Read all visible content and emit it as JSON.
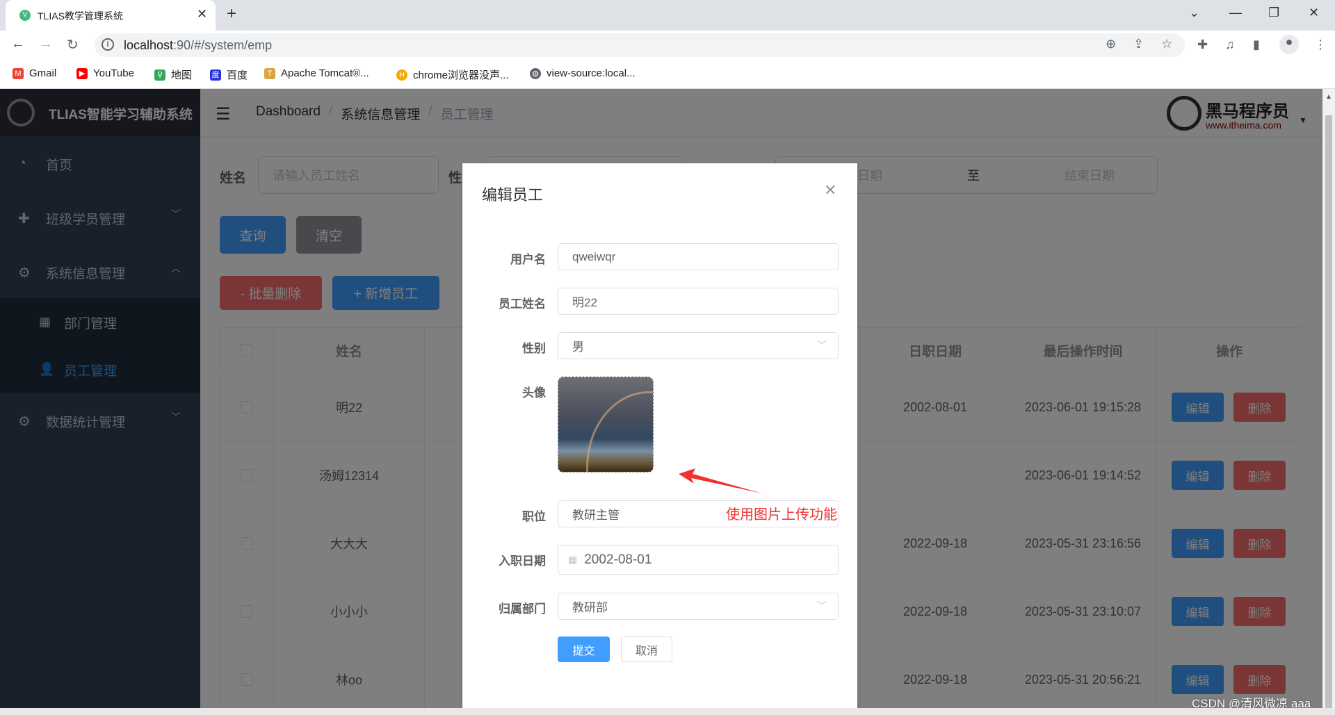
{
  "browser": {
    "tab_title": "TLIAS教学管理系统",
    "url_host": "localhost",
    "url_rest": ":90/#/system/emp",
    "bookmarks": [
      "Gmail",
      "YouTube",
      "地图",
      "百度",
      "Apache Tomcat®...",
      "chrome浏览器没声...",
      "view-source:local..."
    ]
  },
  "app": {
    "title": "TLIAS智能学习辅助系统",
    "brand_name": "黑马程序员",
    "brand_url": "www.itheima.com",
    "breadcrumb": [
      "Dashboard",
      "系统信息管理",
      "员工管理"
    ]
  },
  "sidebar": {
    "items": [
      {
        "label": "首页",
        "icon": "dashboard-icon"
      },
      {
        "label": "班级学员管理",
        "icon": "circle-plus-icon"
      },
      {
        "label": "系统信息管理",
        "icon": "gear-icon"
      },
      {
        "label": "数据统计管理",
        "icon": "gear-icon"
      }
    ],
    "sub_items": [
      {
        "label": "部门管理",
        "icon": "grid-icon"
      },
      {
        "label": "员工管理",
        "icon": "user-icon",
        "active": true
      }
    ]
  },
  "search": {
    "name_label": "姓名",
    "name_placeholder": "请输入员工姓名",
    "gender_label": "性",
    "start_placeholder": "开始日期",
    "range_sep": "至",
    "end_placeholder": "结束日期",
    "query": "查询",
    "clear": "清空",
    "batch_delete": "- 批量删除",
    "add": "+ 新增员工"
  },
  "table": {
    "headers": {
      "name": "姓名",
      "entry_date": "日职日期",
      "update_time": "最后操作时间",
      "actions": "操作"
    },
    "edit": "编辑",
    "delete": "删除",
    "rows": [
      {
        "name": "明22",
        "entry_date": "2002-08-01",
        "update_time": "2023-06-01 19:15:28"
      },
      {
        "name": "汤姆12314",
        "entry_date": "",
        "update_time": "2023-06-01 19:14:52"
      },
      {
        "name": "大大大",
        "entry_date": "2022-09-18",
        "update_time": "2023-05-31 23:16:56"
      },
      {
        "name": "小小小",
        "entry_date": "2022-09-18",
        "update_time": "2023-05-31 23:10:07"
      },
      {
        "name": "林oo",
        "entry_date": "2022-09-18",
        "update_time": "2023-05-31 20:56:21"
      }
    ]
  },
  "dialog": {
    "title": "编辑员工",
    "username_label": "用户名",
    "username": "qweiwqr",
    "name_label": "员工姓名",
    "name": "明22",
    "gender_label": "性别",
    "gender": "男",
    "avatar_label": "头像",
    "job_label": "职位",
    "job": "教研主管",
    "entry_label": "入职日期",
    "entry_date": "2002-08-01",
    "dept_label": "归属部门",
    "dept": "教研部",
    "submit": "提交",
    "cancel": "取消"
  },
  "annotation": {
    "text": "使用图片上传功能",
    "color": "#f23030"
  },
  "watermark": "CSDN @清风微凉 aaa",
  "colors": {
    "primary": "#409eff",
    "danger": "#f56c6c",
    "sidebar": "#304156",
    "info": "#909399"
  }
}
